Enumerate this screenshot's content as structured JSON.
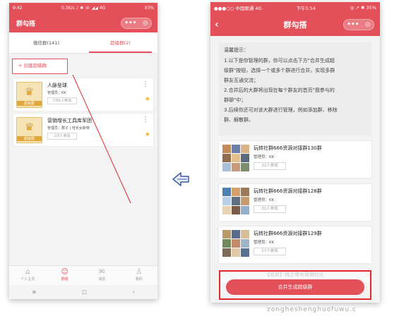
{
  "left_phone": {
    "status": {
      "time": "9:42",
      "speed": "0.3K/s ♪ ✱ ☏ ◢◢ 4G",
      "battery": "93%"
    },
    "title": "群勾搭",
    "capsule_icons": [
      "•••",
      "◎"
    ],
    "tabs": [
      {
        "label": "微信群(141)",
        "active": false
      },
      {
        "label": "超级群(2)",
        "active": true
      }
    ],
    "create_button": "+ 创建超级群",
    "groups": [
      {
        "name": "人脉垒球",
        "manager": "管理员：KK",
        "count": "7/81人参加",
        "badge": "超级群"
      },
      {
        "name": "营销增长工具库军团",
        "manager": "管理员：群子 | 增长女斯特",
        "count": "2/5人参加",
        "badge": "超级群"
      }
    ],
    "bottom_nav": [
      {
        "label": "个人主页",
        "icon": "⌂",
        "active": false
      },
      {
        "label": "群组",
        "icon": "☺",
        "active": true
      },
      {
        "label": "消息",
        "icon": "✉",
        "active": false
      },
      {
        "label": "我的",
        "icon": "♙",
        "active": false
      }
    ],
    "system_nav": [
      "≡",
      "□",
      "‹"
    ]
  },
  "right_phone": {
    "status": {
      "carrier": "●●●○○ 中国联通  4G",
      "time": "下午5:54",
      "battery": "◎ ↗ ✱ 35%"
    },
    "title": "群勾搭",
    "back_icon": "‹",
    "capsule_icons": [
      "•••",
      "◎"
    ],
    "notice": {
      "title": "温馨提示：",
      "lines": [
        "1.以下是你管理的群，你可以点击下方\"合并生成超",
        "级群\"按钮，选择一个或多个群进行合并，实现多群",
        "群友互通交流；",
        "2.合并后的大群将出现在每个群友的首页\"我参与的",
        "群聊\"中；",
        "3.后续你还可对该大群进行管理，例如添加群、移除",
        "群、解散群。"
      ]
    },
    "groups": [
      {
        "name": "玩转社群666资源对接群130群",
        "manager": "管理员：KK",
        "count": "21人参加"
      },
      {
        "name": "玩转社群666资源对接群128群",
        "manager": "管理员：KK",
        "count": "31人参加"
      },
      {
        "name": "玩转社群666资源对接群129群",
        "manager": "管理员：KK",
        "count": "17人参加"
      }
    ],
    "partial_group": "【北京】线上增长营销社区",
    "merge_button": "合并生成超级群"
  },
  "watermark": "zongheshenghuofuwu.c",
  "colors": {
    "brand": "#e3505a",
    "highlight": "#e32a2a",
    "arrow": "#3a58a8",
    "star": "#f1b51c"
  }
}
